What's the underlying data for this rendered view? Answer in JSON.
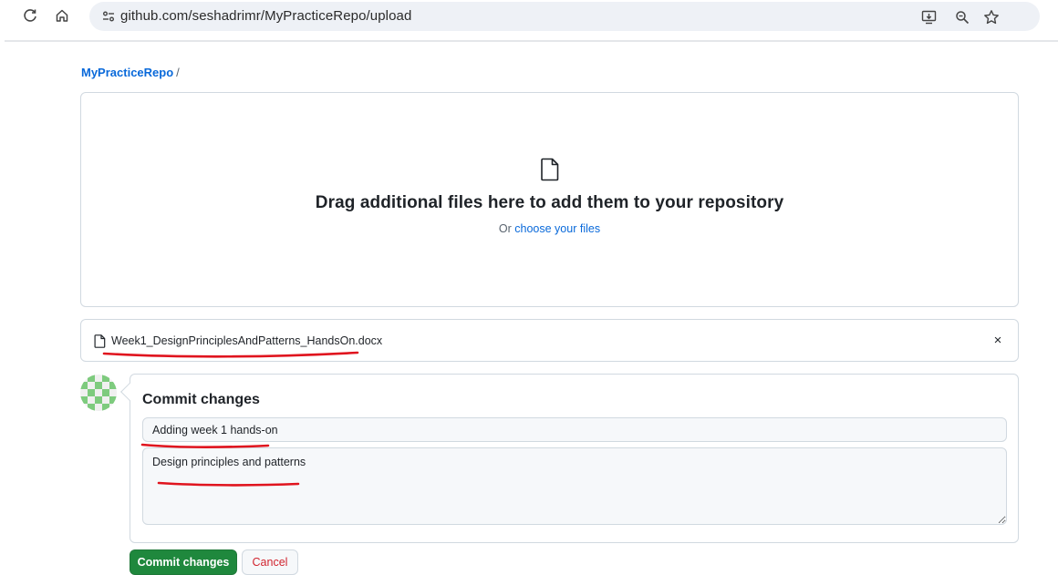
{
  "browser": {
    "url": "github.com/seshadrimr/MyPracticeRepo/upload",
    "icons": [
      "reload-icon",
      "home-icon",
      "site-info-icon",
      "install-app-icon",
      "zoom-icon",
      "bookmark-star-icon"
    ]
  },
  "breadcrumb": {
    "repo": "MyPracticeRepo",
    "separator": "/"
  },
  "dropzone": {
    "title": "Drag additional files here to add them to your repository",
    "or_text": "Or",
    "choose_link": "choose your files"
  },
  "uploaded_file": {
    "name": "Week1_DesignPrinciplesAndPatterns_HandsOn.docx",
    "remove_symbol": "×"
  },
  "commit": {
    "title": "Commit changes",
    "summary_value": "Adding week 1 hands-on",
    "description_value": "Design principles and patterns",
    "commit_button": "Commit changes",
    "cancel_button": "Cancel"
  },
  "colors": {
    "link": "#0969da",
    "commit_green": "#1f883d",
    "cancel_red": "#d1242f",
    "annotation_red": "#e0141e"
  }
}
